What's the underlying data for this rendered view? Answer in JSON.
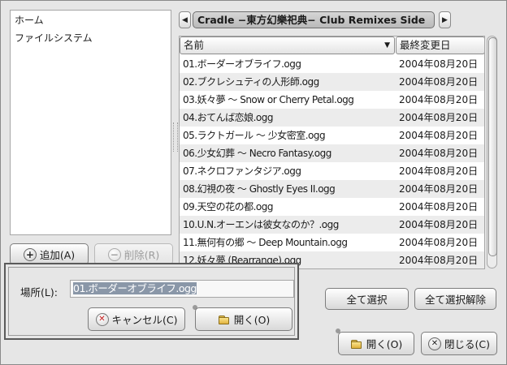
{
  "places": {
    "items": [
      "ホーム",
      "ファイルシステム"
    ],
    "add_label": "追加(A)",
    "remove_label": "削除(R)"
  },
  "path": {
    "current": "Cradle −東方幻樂祀典− Club Remixes Side",
    "back_icon": "◀",
    "forward_icon": "▶"
  },
  "files": {
    "col_name": "名前",
    "col_modified": "最終変更日",
    "sort_icon": "▼",
    "rows": [
      {
        "name": "01.ボーダーオブライフ.ogg",
        "modified": "2004年08月20日"
      },
      {
        "name": "02.ブクレシュティの人形師.ogg",
        "modified": "2004年08月20日"
      },
      {
        "name": "03.妖々夢 〜 Snow or Cherry Petal.ogg",
        "modified": "2004年08月20日"
      },
      {
        "name": "04.おてんば恋娘.ogg",
        "modified": "2004年08月20日"
      },
      {
        "name": "05.ラクトガール 〜 少女密室.ogg",
        "modified": "2004年08月20日"
      },
      {
        "name": "06.少女幻葬 〜 Necro Fantasy.ogg",
        "modified": "2004年08月20日"
      },
      {
        "name": "07.ネクロファンタジア.ogg",
        "modified": "2004年08月20日"
      },
      {
        "name": "08.幻視の夜 〜 Ghostly Eyes II.ogg",
        "modified": "2004年08月20日"
      },
      {
        "name": "09.天空の花の都.ogg",
        "modified": "2004年08月20日"
      },
      {
        "name": "10.U.N.オーエンは彼女なのか？.ogg",
        "modified": "2004年08月20日"
      },
      {
        "name": "11.無何有の郷 〜 Deep Mountain.ogg",
        "modified": "2004年08月20日"
      },
      {
        "name": "12.妖々夢 (Rearrange).ogg",
        "modified": "2004年08月20日"
      }
    ]
  },
  "location": {
    "label": "場所(L):",
    "value": "01.ボーダーオブライフ.ogg"
  },
  "popup_buttons": {
    "cancel": "キャンセル(C)",
    "open": "開く(O)"
  },
  "selection": {
    "select_all": "全て選択",
    "deselect_all": "全て選択解除"
  },
  "dialog_buttons": {
    "open": "開く(O)",
    "close": "閉じる(C)"
  }
}
